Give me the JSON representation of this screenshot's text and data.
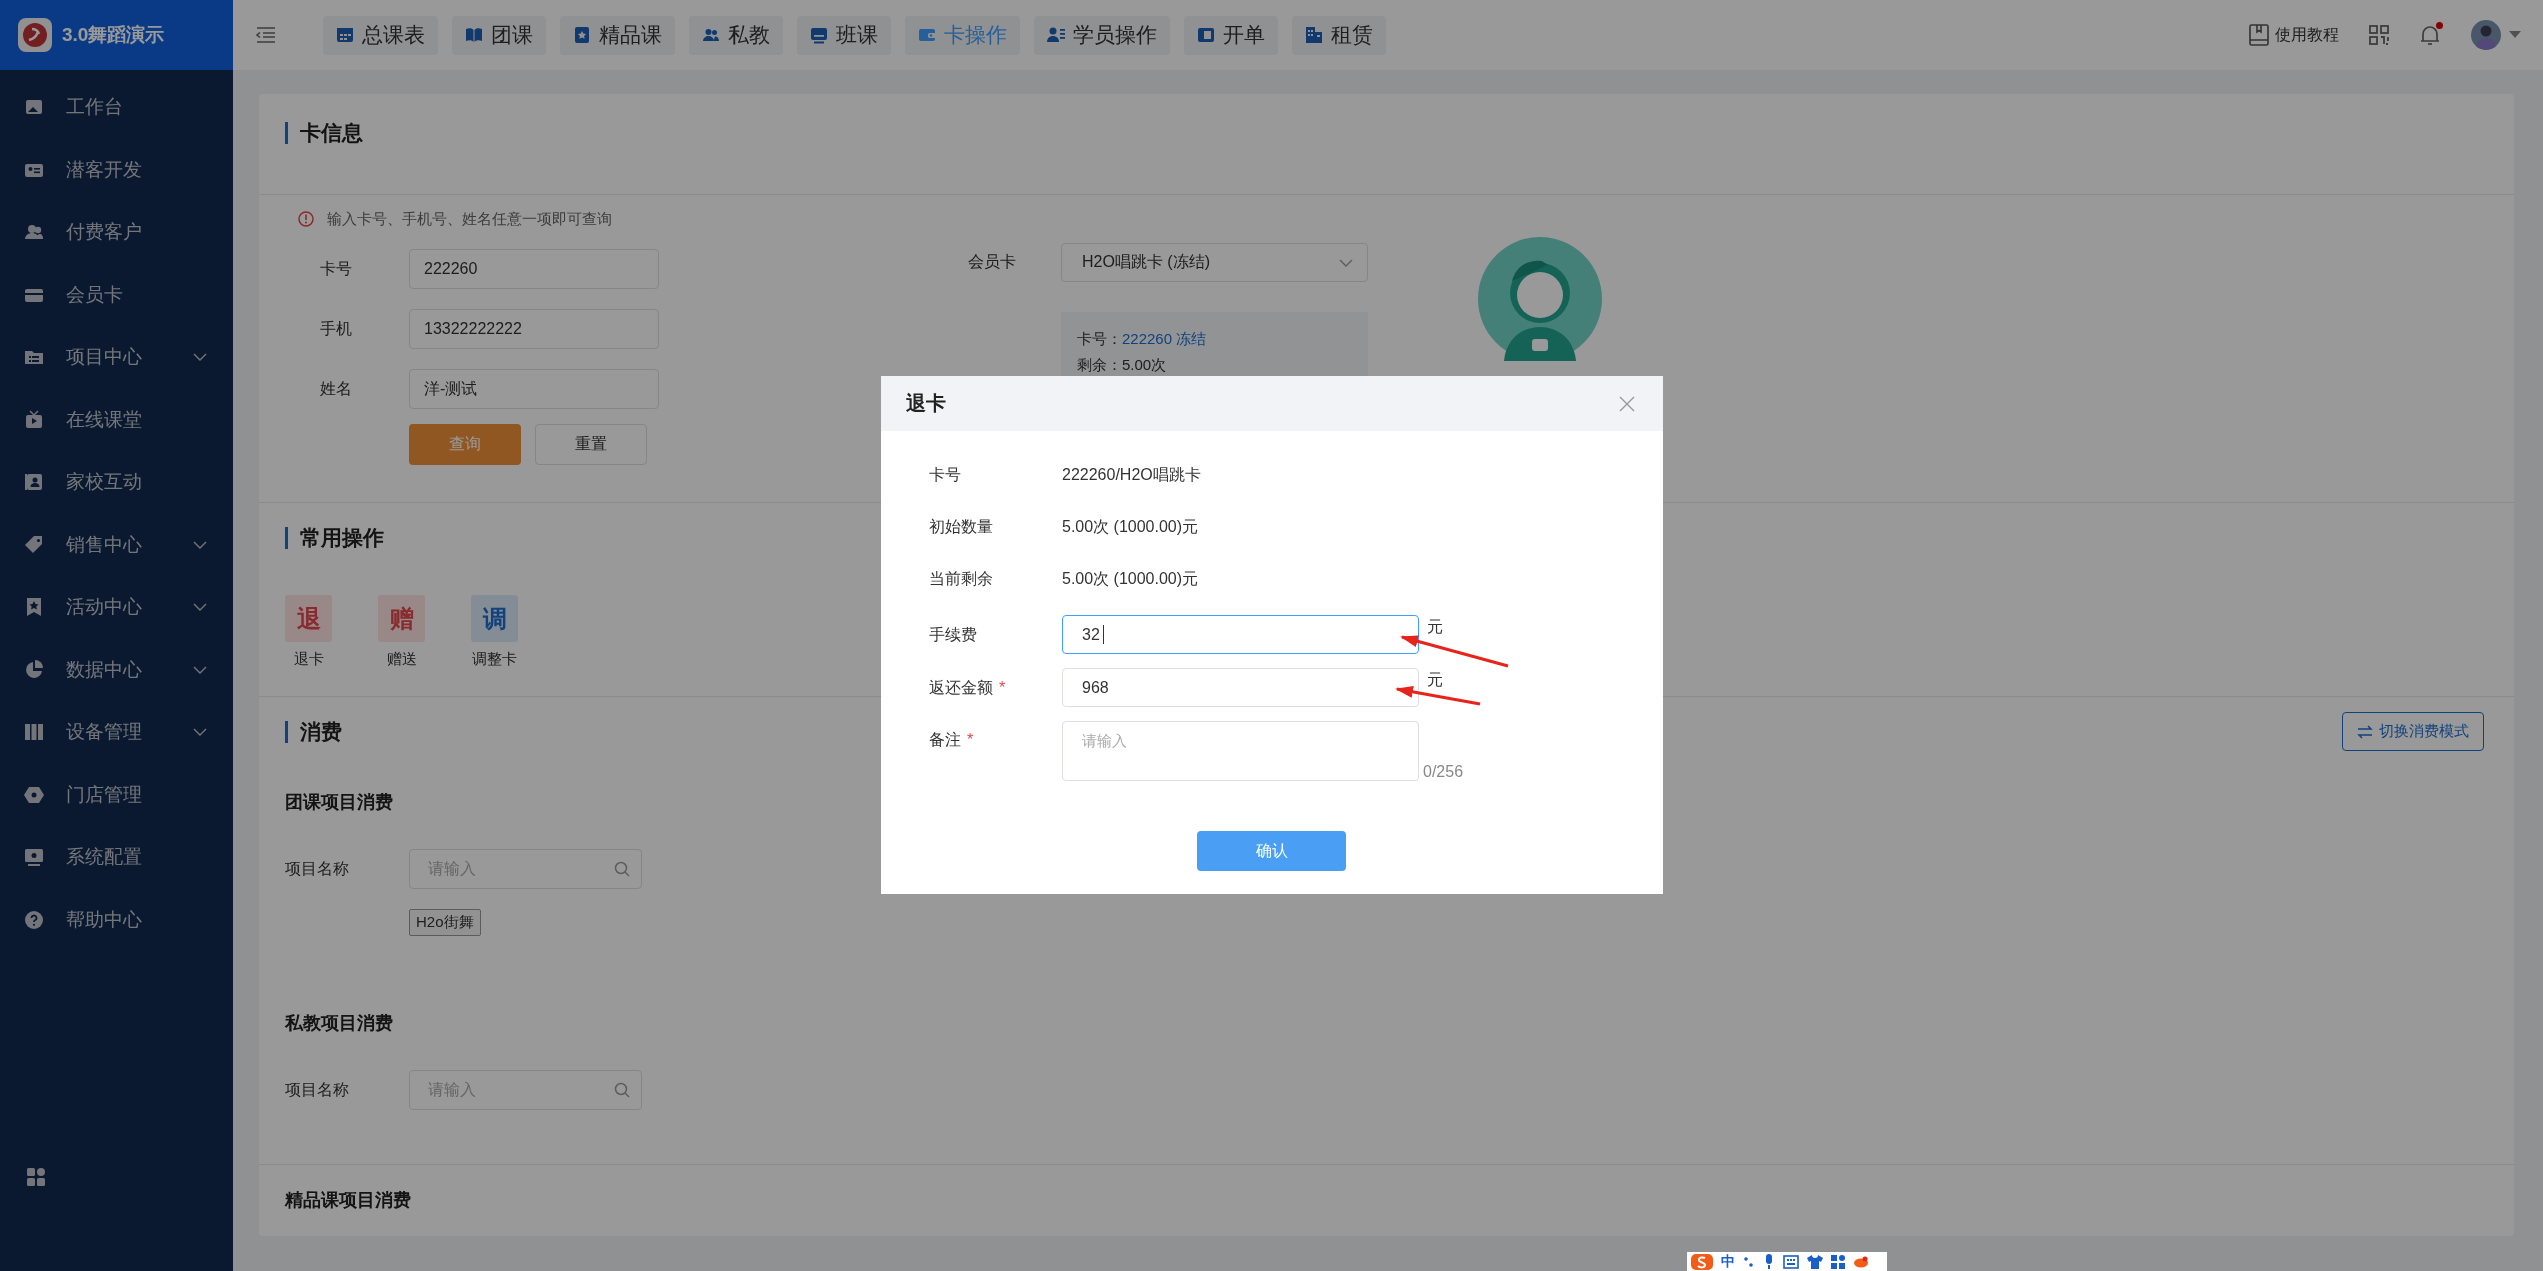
{
  "brand": {
    "name": "3.0舞蹈演示"
  },
  "sidebar": {
    "items": [
      {
        "label": "工作台",
        "expandable": false
      },
      {
        "label": "潜客开发",
        "expandable": false
      },
      {
        "label": "付费客户",
        "expandable": false
      },
      {
        "label": "会员卡",
        "expandable": false
      },
      {
        "label": "项目中心",
        "expandable": true
      },
      {
        "label": "在线课堂",
        "expandable": false
      },
      {
        "label": "家校互动",
        "expandable": false
      },
      {
        "label": "销售中心",
        "expandable": true
      },
      {
        "label": "活动中心",
        "expandable": true
      },
      {
        "label": "数据中心",
        "expandable": true
      },
      {
        "label": "设备管理",
        "expandable": true
      },
      {
        "label": "门店管理",
        "expandable": false
      },
      {
        "label": "系统配置",
        "expandable": false
      },
      {
        "label": "帮助中心",
        "expandable": false
      }
    ]
  },
  "top_tabs": [
    {
      "label": "总课表",
      "selected": false
    },
    {
      "label": "团课",
      "selected": false
    },
    {
      "label": "精品课",
      "selected": false
    },
    {
      "label": "私教",
      "selected": false
    },
    {
      "label": "班课",
      "selected": false
    },
    {
      "label": "卡操作",
      "selected": true
    },
    {
      "label": "学员操作",
      "selected": false
    },
    {
      "label": "开单",
      "selected": false
    },
    {
      "label": "租赁",
      "selected": false
    }
  ],
  "header_right": {
    "help": "使用教程",
    "has_notification": true
  },
  "card_info": {
    "title": "卡信息",
    "hint": "输入卡号、手机号、姓名任意一项即可查询",
    "fields": [
      {
        "label": "卡号",
        "value": "222260"
      },
      {
        "label": "手机",
        "value": "13322222222"
      },
      {
        "label": "姓名",
        "value": "洋-测试"
      }
    ],
    "buttons": [
      {
        "label": "查询",
        "kind": "primary"
      },
      {
        "label": "重置",
        "kind": "default"
      }
    ],
    "member_card": {
      "label": "会员卡",
      "value": "H2O唱跳卡 (冻结)",
      "info": [
        {
          "label": "卡号：",
          "value": "222260 冻结"
        },
        {
          "label": "剩余：5.00次"
        }
      ]
    }
  },
  "quick_actions": {
    "title": "常用操作",
    "items": [
      {
        "glyph": "退",
        "label": "退卡"
      },
      {
        "glyph": "赠",
        "label": "赠送"
      },
      {
        "glyph": "调",
        "label": "调整卡"
      }
    ]
  },
  "consumption": {
    "title": "消费",
    "switch_button": "切换消费模式",
    "sections": [
      {
        "title": "团课项目消费",
        "search": {
          "label": "项目名称",
          "placeholder": "请输入"
        },
        "tags": [
          "H2o街舞"
        ]
      },
      {
        "title": "私教项目消费",
        "search": {
          "label": "项目名称",
          "placeholder": "请输入"
        }
      },
      {
        "title": "精品课项目消费"
      }
    ]
  },
  "dialog": {
    "title": "退卡",
    "rows": [
      {
        "kind": "text",
        "label": "卡号",
        "value": "222260/H2O唱跳卡"
      },
      {
        "kind": "text",
        "label": "初始数量",
        "value": "5.00次 (1000.00)元"
      },
      {
        "kind": "text",
        "label": "当前剩余",
        "value": "5.00次 (1000.00)元"
      },
      {
        "kind": "input",
        "label": "手续费",
        "value": "32",
        "unit": "元",
        "focused": true
      },
      {
        "kind": "input",
        "label": "返还金额",
        "required_mark": "*",
        "value": "968",
        "unit": "元",
        "focused": false
      },
      {
        "kind": "textarea",
        "label": "备注",
        "required_mark": "*",
        "placeholder": "请输入",
        "counter": "0/256"
      }
    ],
    "confirm": "确认"
  },
  "ime_bar": {
    "mode": "中"
  }
}
